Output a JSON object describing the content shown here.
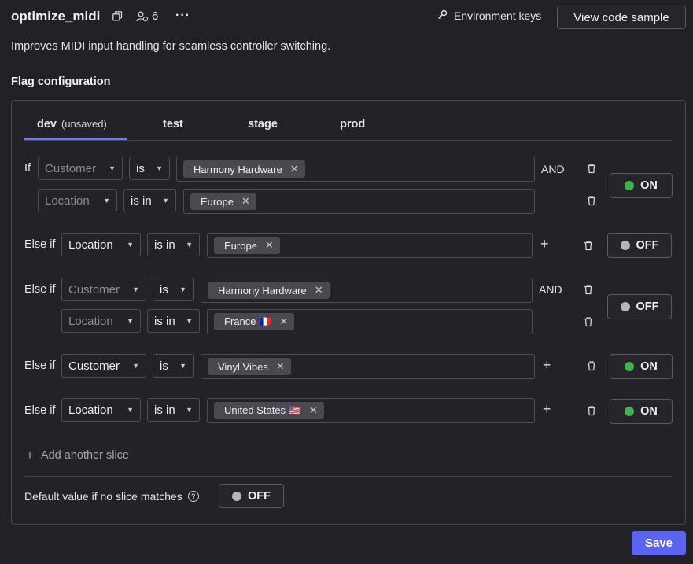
{
  "header": {
    "flag_name": "optimize_midi",
    "member_count": "6",
    "environment_keys_label": "Environment keys",
    "view_code_label": "View code sample"
  },
  "description": "Improves MIDI input handling for seamless controller switching.",
  "section_title": "Flag configuration",
  "tabs": [
    {
      "label": "dev",
      "suffix": "(unsaved)",
      "active": true
    },
    {
      "label": "test"
    },
    {
      "label": "stage"
    },
    {
      "label": "prod"
    }
  ],
  "slices": [
    {
      "conditions": [
        {
          "prefix": "If",
          "attribute": "Customer",
          "operator": "is",
          "values": [
            "Harmony Hardware"
          ],
          "joiner": "AND"
        },
        {
          "attribute": "Location",
          "operator": "is in",
          "values": [
            "Europe"
          ]
        }
      ],
      "state": "ON"
    },
    {
      "conditions": [
        {
          "prefix": "Else if",
          "attribute": "Location",
          "operator": "is in",
          "values": [
            "Europe"
          ]
        }
      ],
      "state": "OFF"
    },
    {
      "conditions": [
        {
          "prefix": "Else if",
          "attribute": "Customer",
          "operator": "is",
          "values": [
            "Harmony Hardware"
          ],
          "joiner": "AND"
        },
        {
          "attribute": "Location",
          "operator": "is in",
          "values": [
            "France 🇫🇷"
          ]
        }
      ],
      "state": "OFF"
    },
    {
      "conditions": [
        {
          "prefix": "Else if",
          "attribute": "Customer",
          "operator": "is",
          "values": [
            "Vinyl Vibes"
          ]
        }
      ],
      "state": "ON"
    },
    {
      "conditions": [
        {
          "prefix": "Else if",
          "attribute": "Location",
          "operator": "is in",
          "values": [
            "United States 🇺🇸"
          ]
        }
      ],
      "state": "ON"
    }
  ],
  "add_slice_label": "Add another slice",
  "default_label": "Default value if no slice matches",
  "default_state": "OFF",
  "save_label": "Save",
  "icons": {
    "copy": "copy-icon",
    "members": "members-icon",
    "more": "more-icon",
    "key": "key-icon",
    "delete": "trash-icon",
    "add": "plus-icon",
    "help": "help-icon",
    "remove_value": "close-icon",
    "dropdown": "chevron-down-icon"
  },
  "colors": {
    "accent": "#5B63F2",
    "tab_indicator": "#6A7BFF",
    "on": "#3FB24F",
    "off": "#B6B5BB",
    "background": "#222126"
  }
}
